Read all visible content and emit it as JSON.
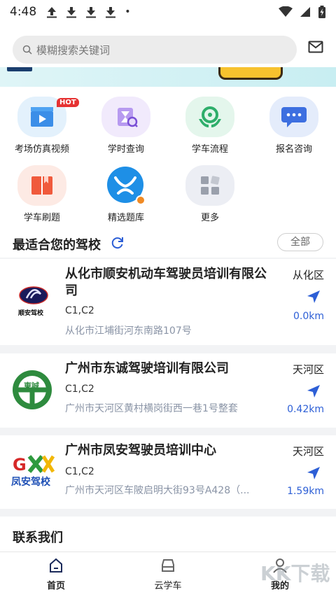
{
  "status_bar": {
    "time": "4:48",
    "dot": "•"
  },
  "search": {
    "placeholder": "模糊搜索关键词"
  },
  "grid": [
    {
      "label": "考场仿真视频",
      "badge": "HOT",
      "icon": "video-icon"
    },
    {
      "label": "学时查询",
      "icon": "hourglass-search-icon"
    },
    {
      "label": "学车流程",
      "icon": "steering-wheel-icon"
    },
    {
      "label": "报名咨询",
      "icon": "chat-icon"
    },
    {
      "label": "学车刷题",
      "icon": "book-icon"
    },
    {
      "label": "精选题库",
      "icon": "app-logo-icon"
    },
    {
      "label": "更多",
      "icon": "more-grid-icon"
    }
  ],
  "section": {
    "title": "最适合您的驾校",
    "all_label": "全部"
  },
  "schools": [
    {
      "name": "从化市顺安机动车驾驶员培训有限公司",
      "license": "C1,C2",
      "address": "从化市江埔街河东南路107号",
      "district": "从化区",
      "distance": "0.0km",
      "logo_text": "顺安驾校"
    },
    {
      "name": "广州市东诚驾驶培训有限公司",
      "license": "C1,C2",
      "address": "广州市天河区黄村横岗街西一巷1号整套",
      "district": "天河区",
      "distance": "0.42km",
      "logo_text": "東誠"
    },
    {
      "name": "广州市凤安驾驶员培训中心",
      "license": "C1,C2",
      "address": "广州市天河区车陂启明大街93号A428（...",
      "district": "天河区",
      "distance": "1.59km",
      "logo_text": "凤安驾校"
    }
  ],
  "contact": {
    "title": "联系我们"
  },
  "tabs": [
    {
      "label": "首页",
      "icon": "home-icon"
    },
    {
      "label": "云学车",
      "icon": "car-icon"
    },
    {
      "label": "我的",
      "icon": "person-icon"
    }
  ],
  "watermark": "KK下载",
  "colors": {
    "accent": "#2d5fd6",
    "address": "#8a94a6"
  }
}
